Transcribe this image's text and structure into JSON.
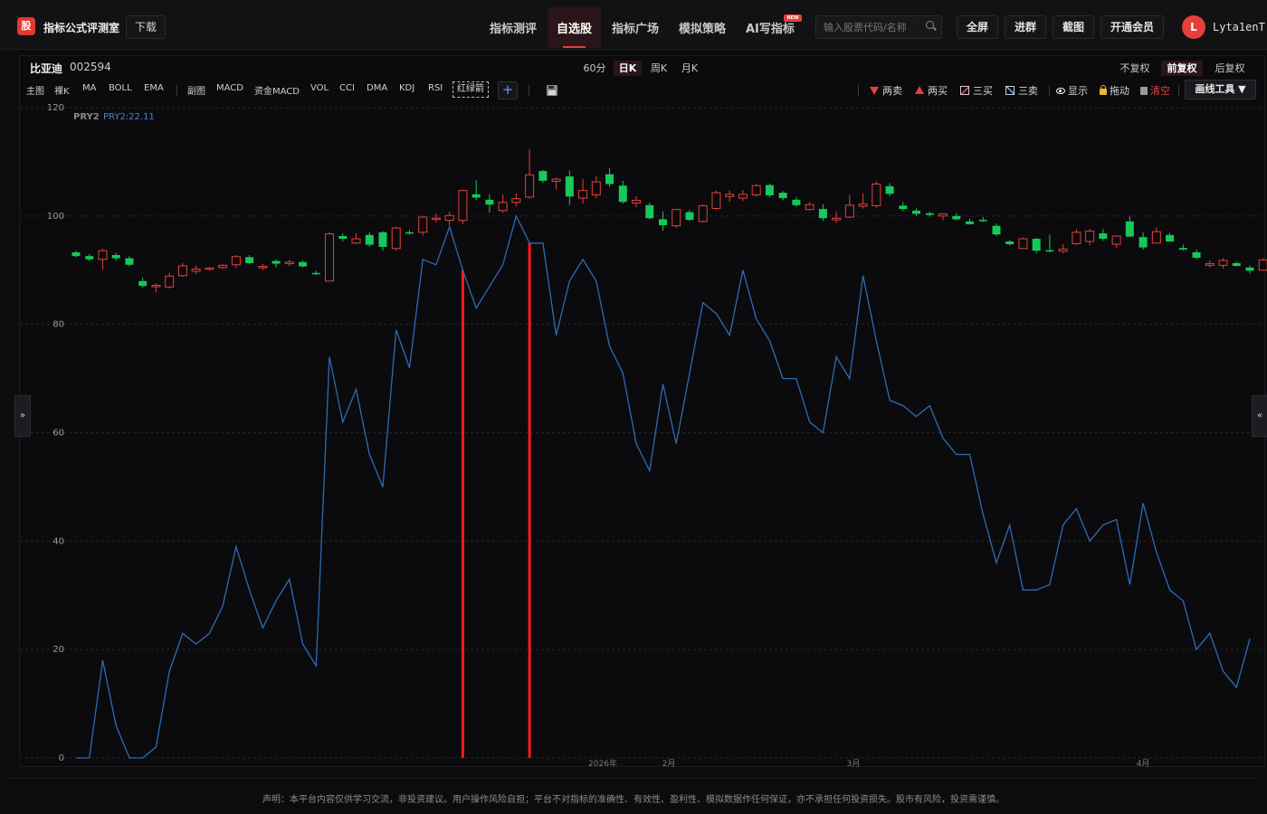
{
  "header": {
    "logo_char": "股",
    "brand": "指标公式评测室",
    "download": "下载",
    "nav": [
      {
        "label": "指标测评"
      },
      {
        "label": "自选股"
      },
      {
        "label": "指标广场"
      },
      {
        "label": "模拟策略"
      },
      {
        "label": "AI写指标"
      }
    ],
    "new_badge": "NEW",
    "search_placeholder": "输入股票代码/名称",
    "buttons": [
      "全屏",
      "进群",
      "截图",
      "开通会员"
    ],
    "avatar_letter": "L",
    "username": "Lyta1enT"
  },
  "stock": {
    "name": "比亚迪",
    "code": "002594"
  },
  "periods": [
    "60分",
    "日K",
    "周K",
    "月K"
  ],
  "active_period": "日K",
  "adjust": [
    "不复权",
    "前复权",
    "后复权"
  ],
  "active_adjust": "前复权",
  "indicators_main": [
    "主图",
    "裸K",
    "MA",
    "BOLL",
    "EMA"
  ],
  "indicators_sub": [
    "副图",
    "MACD",
    "资金MACD",
    "VOL",
    "CCI",
    "DMA",
    "KDJ",
    "RSI"
  ],
  "indicator_custom": "红绿箭",
  "plus_label": "+",
  "tools": {
    "two_sell": "两卖",
    "two_buy": "两买",
    "three_buy": "三买",
    "three_sell": "三卖",
    "show": "显示",
    "drag": "拖动",
    "clear": "清空",
    "draw_tool": "画线工具 ▼"
  },
  "legend": {
    "series_name": "PRY2",
    "series_value": "PRY2:22.11"
  },
  "side_left": "»",
  "side_right": "«",
  "disclaimer": "声明：本平台内容仅供学习交流，非投资建议。用户操作风险自担；平台不对指标的准确性、有效性、盈利性、模拟数据作任何保证，亦不承担任何投资损失。股市有风险，投资需谨慎。",
  "colors": {
    "up": "#e5403a",
    "down": "#16c95a",
    "line": "#2f6bb3",
    "marker": "#ff1a1a"
  },
  "chart_data": {
    "type": "line",
    "ylim": [
      0,
      120
    ],
    "yticks": [
      "0",
      "20",
      "40",
      "60",
      "80",
      "100",
      "120"
    ],
    "xtick_labels": [
      "2026年",
      "2月",
      "3月",
      "4月"
    ],
    "marker_lines": [
      29,
      34
    ],
    "series": [
      {
        "name": "PRY2",
        "values": [
          0,
          0,
          18,
          6,
          0,
          0,
          2,
          16,
          23,
          21,
          23,
          28,
          39,
          31,
          24,
          29,
          33,
          21,
          17,
          74,
          62,
          68,
          56,
          50,
          79,
          72,
          92,
          91,
          98,
          90,
          83,
          87,
          91,
          100,
          95,
          95,
          78,
          88,
          92,
          88,
          76,
          71,
          58,
          53,
          69,
          58,
          71,
          84,
          82,
          78,
          90,
          81,
          77,
          70,
          70,
          62,
          60,
          74,
          70,
          89,
          77,
          66,
          65,
          63,
          65,
          59,
          56,
          56,
          45,
          36,
          43,
          31,
          31,
          32,
          43,
          46,
          40,
          43,
          44,
          32,
          47,
          38,
          31,
          29,
          20,
          23,
          16,
          13,
          22
        ]
      }
    ],
    "candles_ohlc": [
      [
        93.3,
        93.6,
        92.4,
        92.6
      ],
      [
        92.6,
        93.0,
        91.7,
        92.0
      ],
      [
        92.0,
        93.9,
        90.1,
        93.6
      ],
      [
        92.8,
        93.2,
        91.8,
        92.2
      ],
      [
        92.2,
        92.6,
        90.7,
        91.0
      ],
      [
        88.0,
        88.6,
        86.8,
        87.1
      ],
      [
        87.1,
        87.6,
        85.9,
        87.2
      ],
      [
        86.9,
        89.5,
        86.6,
        88.9
      ],
      [
        89.0,
        91.3,
        88.8,
        90.8
      ],
      [
        89.8,
        90.9,
        89.3,
        90.2
      ],
      [
        90.2,
        90.6,
        89.9,
        90.4
      ],
      [
        90.5,
        91.1,
        90.2,
        90.9
      ],
      [
        91.0,
        92.8,
        90.4,
        92.5
      ],
      [
        92.4,
        92.8,
        91.1,
        91.3
      ],
      [
        90.5,
        91.2,
        90.0,
        90.7
      ],
      [
        91.7,
        92.0,
        90.5,
        91.2
      ],
      [
        91.2,
        91.9,
        90.8,
        91.5
      ],
      [
        91.5,
        91.8,
        90.5,
        90.7
      ],
      [
        89.5,
        89.9,
        89.1,
        89.4
      ],
      [
        88.0,
        97.0,
        88.0,
        96.7
      ],
      [
        96.3,
        96.8,
        95.3,
        95.8
      ],
      [
        95.0,
        96.8,
        94.8,
        95.8
      ],
      [
        96.5,
        97.0,
        94.3,
        94.7
      ],
      [
        97.0,
        97.2,
        93.6,
        94.3
      ],
      [
        94.0,
        98.0,
        93.6,
        97.8
      ],
      [
        97.0,
        97.4,
        96.6,
        96.8
      ],
      [
        97.0,
        100.0,
        96.4,
        99.8
      ],
      [
        99.4,
        100.5,
        98.8,
        99.6
      ],
      [
        99.2,
        100.8,
        98.3,
        100.1
      ],
      [
        99.2,
        104.9,
        98.5,
        104.7
      ],
      [
        104.0,
        106.6,
        103.0,
        103.4
      ],
      [
        103.0,
        104.0,
        100.6,
        102.1
      ],
      [
        101.0,
        104.0,
        100.6,
        102.5
      ],
      [
        102.5,
        104.2,
        101.8,
        103.2
      ],
      [
        103.5,
        112.3,
        103.2,
        107.6
      ],
      [
        108.3,
        108.5,
        106.1,
        106.5
      ],
      [
        106.4,
        107.1,
        104.9,
        106.8
      ],
      [
        107.3,
        108.4,
        102.0,
        103.6
      ],
      [
        103.3,
        106.8,
        102.3,
        104.7
      ],
      [
        103.9,
        107.4,
        103.3,
        106.3
      ],
      [
        107.7,
        108.8,
        105.4,
        105.9
      ],
      [
        105.6,
        106.5,
        102.3,
        102.6
      ],
      [
        102.4,
        103.6,
        101.6,
        102.9
      ],
      [
        102.0,
        102.5,
        99.4,
        99.6
      ],
      [
        99.4,
        100.8,
        97.3,
        98.3
      ],
      [
        98.2,
        101.2,
        97.8,
        101.2
      ],
      [
        100.7,
        101.1,
        99.0,
        99.3
      ],
      [
        99.0,
        102.1,
        98.8,
        101.9
      ],
      [
        101.4,
        104.7,
        101.1,
        104.3
      ],
      [
        103.6,
        104.7,
        102.6,
        104.0
      ],
      [
        103.3,
        104.8,
        102.8,
        104.0
      ],
      [
        103.9,
        105.9,
        103.6,
        105.6
      ],
      [
        105.7,
        106.0,
        103.4,
        103.8
      ],
      [
        104.3,
        104.6,
        102.9,
        103.3
      ],
      [
        103.0,
        103.5,
        101.7,
        102.0
      ],
      [
        101.2,
        102.6,
        101.0,
        102.1
      ],
      [
        101.3,
        102.2,
        99.1,
        99.6
      ],
      [
        99.3,
        100.8,
        98.7,
        99.6
      ],
      [
        99.8,
        103.9,
        99.6,
        102.0
      ],
      [
        101.8,
        104.2,
        101.4,
        102.2
      ],
      [
        101.9,
        106.4,
        101.5,
        105.9
      ],
      [
        105.5,
        106.1,
        103.7,
        104.1
      ],
      [
        101.9,
        102.6,
        100.9,
        101.3
      ],
      [
        101.0,
        101.4,
        100.0,
        100.4
      ],
      [
        100.5,
        100.8,
        99.9,
        100.2
      ],
      [
        100.0,
        100.5,
        99.2,
        100.4
      ],
      [
        100.0,
        100.5,
        99.2,
        99.4
      ],
      [
        99.0,
        99.5,
        98.4,
        98.5
      ],
      [
        99.3,
        99.8,
        98.9,
        99.1
      ],
      [
        98.2,
        98.6,
        96.3,
        96.6
      ],
      [
        95.3,
        95.6,
        94.5,
        94.8
      ],
      [
        94.0,
        96.0,
        94.0,
        95.8
      ],
      [
        95.8,
        96.0,
        93.1,
        93.6
      ],
      [
        93.7,
        96.6,
        93.3,
        93.6
      ],
      [
        93.5,
        94.8,
        93.1,
        93.9
      ],
      [
        94.9,
        97.6,
        94.7,
        97.0
      ],
      [
        95.3,
        97.6,
        94.6,
        97.2
      ],
      [
        96.8,
        97.6,
        95.4,
        95.8
      ],
      [
        94.8,
        96.4,
        94.1,
        96.3
      ],
      [
        99.0,
        99.9,
        96.1,
        96.2
      ],
      [
        96.1,
        97.0,
        93.8,
        94.2
      ],
      [
        95.0,
        97.9,
        94.9,
        97.1
      ],
      [
        96.5,
        96.9,
        95.2,
        95.3
      ],
      [
        94.1,
        94.7,
        93.6,
        93.8
      ],
      [
        93.3,
        93.8,
        92.0,
        92.3
      ],
      [
        90.9,
        91.8,
        90.5,
        91.2
      ],
      [
        90.9,
        92.2,
        90.3,
        91.8
      ],
      [
        91.3,
        91.6,
        90.7,
        90.8
      ],
      [
        90.5,
        90.9,
        89.4,
        89.9
      ],
      [
        90.0,
        92.2,
        89.9,
        91.9
      ]
    ]
  }
}
